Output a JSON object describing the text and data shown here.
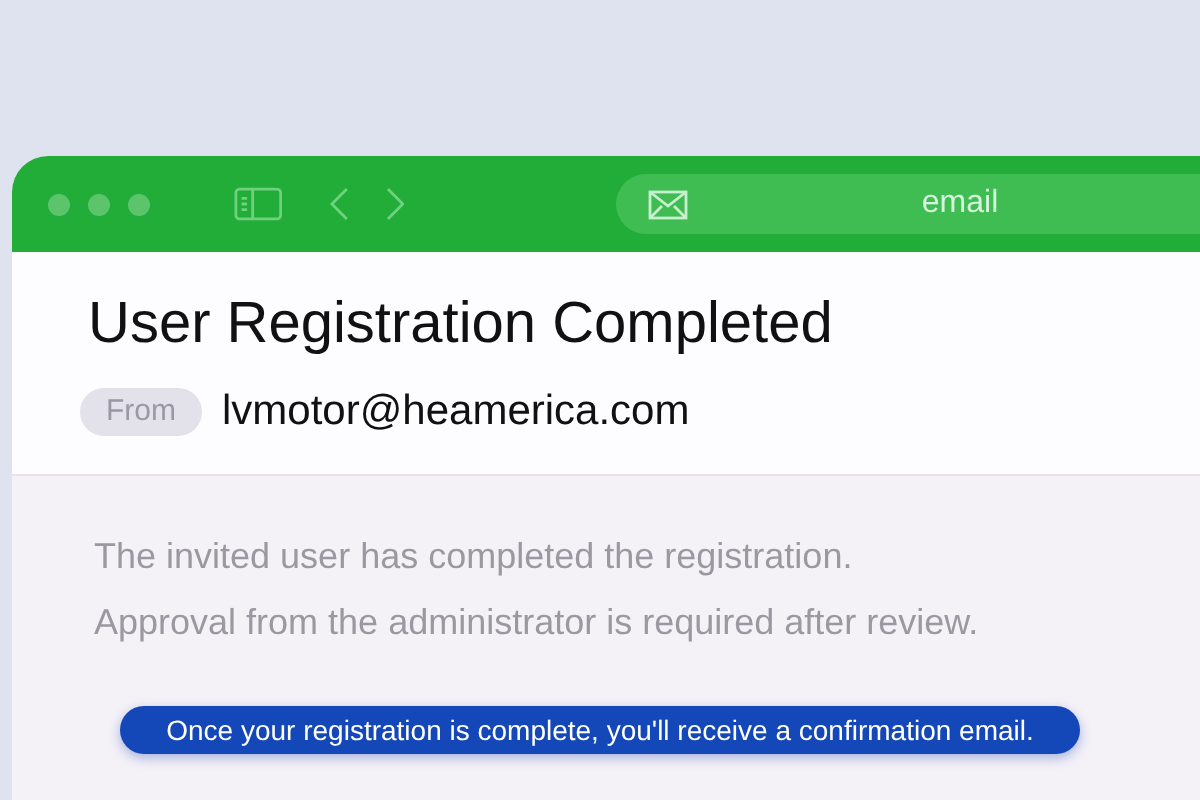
{
  "window": {
    "address": "email"
  },
  "email": {
    "subject": "User Registration Completed",
    "from_label": "From",
    "sender": "lvmotor@heamerica.com",
    "body": [
      "The invited user has completed the registration.",
      "Approval from the administrator is required after review."
    ]
  },
  "caption": "Once your registration is complete, you'll receive a confirmation email."
}
